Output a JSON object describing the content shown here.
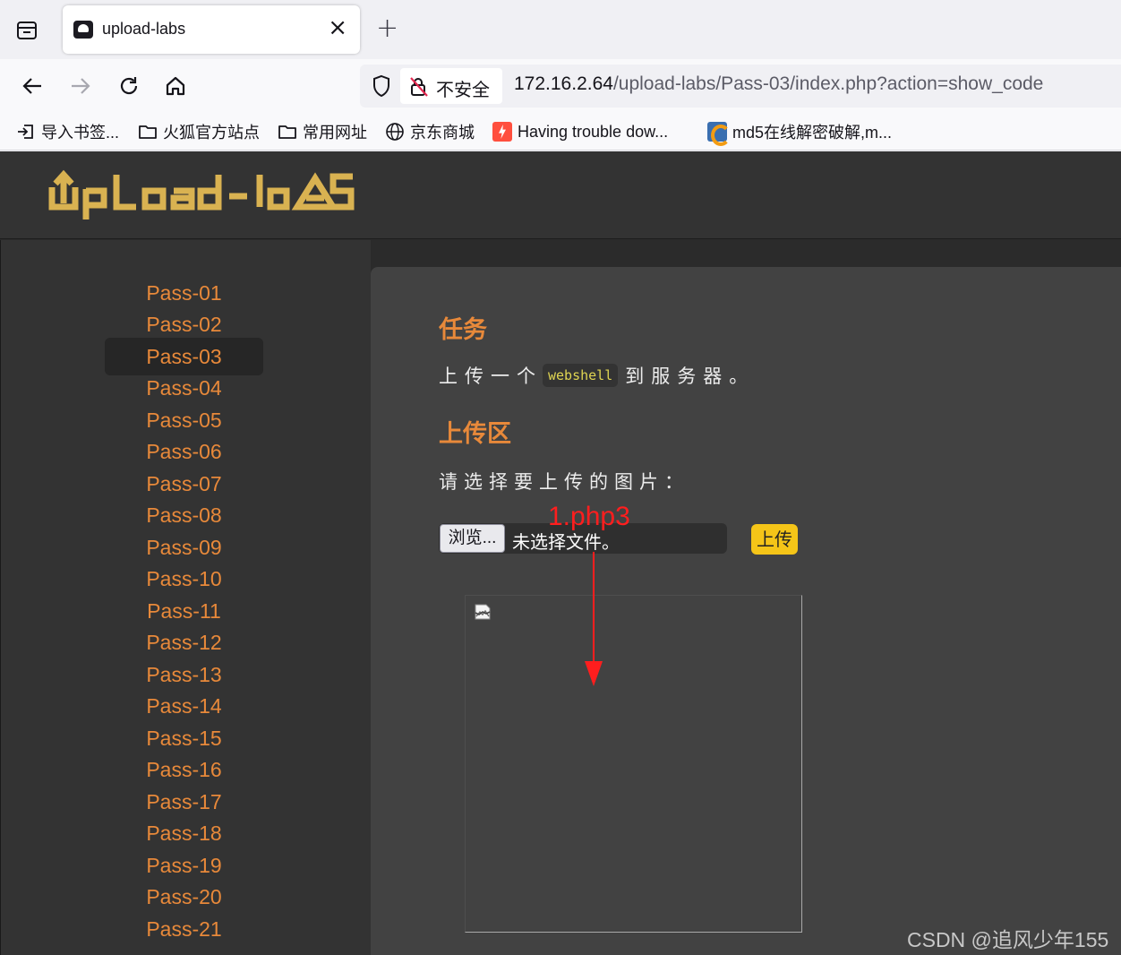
{
  "browser": {
    "tab": {
      "title": "upload-labs"
    },
    "security_label": "不安全",
    "url": {
      "host": "172.16.2.64",
      "path": "/upload-labs/Pass-03/index.php?action=show_code"
    },
    "bookmarks": [
      {
        "label": "导入书签...",
        "icon": "import-icon"
      },
      {
        "label": "火狐官方站点",
        "icon": "folder-icon"
      },
      {
        "label": "常用网址",
        "icon": "folder-icon"
      },
      {
        "label": "京东商城",
        "icon": "globe-icon"
      },
      {
        "label": "Having trouble dow...",
        "icon": "bolt-icon"
      },
      {
        "label": "md5在线解密破解,m...",
        "icon": "cmd5-icon"
      }
    ]
  },
  "site": {
    "logo_text": "UpLoad-labs",
    "logo_color": "#d9b251",
    "accent_color": "#e8893a",
    "sidebar": {
      "active_index": 2,
      "items": [
        "Pass-01",
        "Pass-02",
        "Pass-03",
        "Pass-04",
        "Pass-05",
        "Pass-06",
        "Pass-07",
        "Pass-08",
        "Pass-09",
        "Pass-10",
        "Pass-11",
        "Pass-12",
        "Pass-13",
        "Pass-14",
        "Pass-15",
        "Pass-16",
        "Pass-17",
        "Pass-18",
        "Pass-19",
        "Pass-20",
        "Pass-21"
      ]
    },
    "main": {
      "task_heading": "任务",
      "task_before": "上传一个",
      "task_code": "webshell",
      "task_after": "到服务器。",
      "upload_heading": "上传区",
      "prompt": "请选择要上传的图片：",
      "browse_label": "浏览...",
      "no_file_label": "未选择文件。",
      "submit_label": "上传"
    }
  },
  "annotation": {
    "text": "1.php3",
    "color": "#ff1e1e"
  },
  "watermark": "CSDN @追风少年155"
}
